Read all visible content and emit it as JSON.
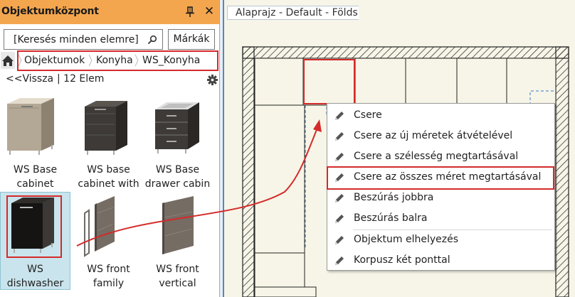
{
  "panel": {
    "title": "Objektumközpont",
    "close_symbol": "✕",
    "pin_icon": "pin-icon",
    "search": {
      "value": "[Keresés minden elemre]",
      "icon": "search-icon"
    },
    "brand_button": "Márkák",
    "breadcrumb": [
      "Objektumok",
      "Konyha",
      "WS_Konyha"
    ],
    "back_link": "<<Vissza",
    "count": "| 12 Elem",
    "items": [
      {
        "line1": "WS Base",
        "line2": "cabinet"
      },
      {
        "line1": "WS base",
        "line2": "cabinet with"
      },
      {
        "line1": "WS Base",
        "line2": "drawer cabin"
      },
      {
        "line1": "WS",
        "line2": "dishwasher"
      },
      {
        "line1": "WS front",
        "line2": "family"
      },
      {
        "line1": "WS front",
        "line2": "vertical"
      }
    ]
  },
  "view": {
    "title": "Alaprajz - Default - Földs"
  },
  "context_menu": {
    "items": [
      "Csere",
      "Csere az új méretek átvételével",
      "Csere a szélesség megtartásával",
      "Csere az összes méret megtartásával",
      "Beszúrás jobbra",
      "Beszúrás balra",
      "Objektum elhelyezés",
      "Korpusz két ponttal"
    ],
    "highlighted_index": 3
  },
  "colors": {
    "title_bar": "#f4a64e",
    "highlight_red": "#d42a2a",
    "selection_bg": "#c9e4ec",
    "view_bg": "#f7f5e7",
    "guide_blue": "#3a78c8"
  }
}
